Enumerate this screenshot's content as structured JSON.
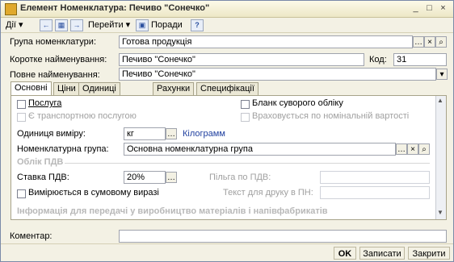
{
  "window": {
    "title": "Елемент Номенклатура: Печиво \"Сонечко\"",
    "min_glyph": "_",
    "max_glyph": "□",
    "close_glyph": "×"
  },
  "toolbar": {
    "actions_label": "Дії",
    "goto_label": "Перейти",
    "help_label": "Поради"
  },
  "header": {
    "group_label": "Група номенклатури:",
    "group_value": "Готова продукція",
    "short_name_label": "Коротке найменування:",
    "short_name_value": "Печиво \"Сонечко\"",
    "code_label": "Код:",
    "code_value": "31",
    "full_name_label": "Повне найменування:",
    "full_name_value": "Печиво \"Сонечко\""
  },
  "tabs": [
    "Основні",
    "Ціни",
    "Одиниці виміру",
    "Рахунки",
    "Специфікації"
  ],
  "main": {
    "service_label": "Послуга",
    "transport_label": "Є транспортною послугою",
    "strict_form_label": "Бланк суворого обліку",
    "nominal_label": "Враховується по номінальній вартості",
    "unit_label": "Одиниця виміру:",
    "unit_value": "кг",
    "unit_full": "Кілограмм",
    "nom_group_label": "Номенклатурна група:",
    "nom_group_value": "Основна номенклатурна група",
    "vat_section": "Облік ПДВ",
    "vat_rate_label": "Ставка ПДВ:",
    "vat_rate_value": "20%",
    "vat_benefit_label": "Пільга по ПДВ:",
    "sum_expr_label": "Вимірюється в сумовому виразі",
    "print_text_label": "Текст для друку в ПН:",
    "production_section": "Інформація для передачі у виробництво матеріалів і напівфабрикатів"
  },
  "footer": {
    "comment_label": "Коментар:",
    "ok_label": "OK",
    "save_label": "Записати",
    "close_label": "Закрити"
  }
}
